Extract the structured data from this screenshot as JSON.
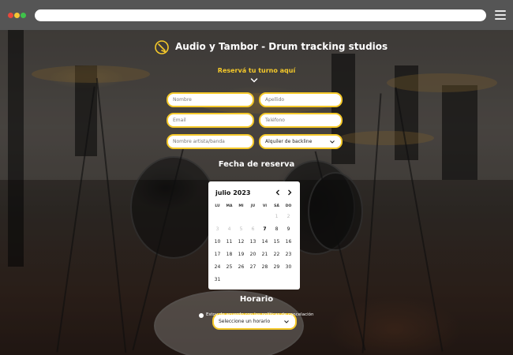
{
  "browser": {
    "url": ""
  },
  "header": {
    "title": "Audio y Tambor - Drum tracking studios",
    "subtitle": "Reservá tu turno aquí"
  },
  "form": {
    "nombre_placeholder": "Nombre",
    "apellido_placeholder": "Apellido",
    "email_placeholder": "Email",
    "telefono_placeholder": "Teléfono",
    "artista_placeholder": "Nombre artista/banda",
    "backline_selected": "Alquiler de backline"
  },
  "fecha": {
    "title": "Fecha de reserva"
  },
  "calendar": {
    "month_label": "julio 2023",
    "weekdays": [
      "LU",
      "MA",
      "MI",
      "JU",
      "VI",
      "SÁ",
      "DO"
    ],
    "weeks": [
      [
        "",
        "",
        "",
        "",
        "",
        "1",
        "2"
      ],
      [
        "3",
        "4",
        "5",
        "6",
        "7",
        "8",
        "9"
      ],
      [
        "10",
        "11",
        "12",
        "13",
        "14",
        "15",
        "16"
      ],
      [
        "17",
        "18",
        "19",
        "20",
        "21",
        "22",
        "23"
      ],
      [
        "24",
        "25",
        "26",
        "27",
        "28",
        "29",
        "30"
      ],
      [
        "31",
        "",
        "",
        "",
        "",
        "",
        ""
      ]
    ],
    "disabled_days": [
      "1",
      "2",
      "3",
      "4",
      "5",
      "6"
    ],
    "today": "7"
  },
  "horario": {
    "title": "Horario",
    "selected": "Seleccione un horario"
  },
  "terms": {
    "label": "Estoy de acuerdo con las políticas de cancelación"
  },
  "colors": {
    "accent": "#f5c92a",
    "chrome": "#555555"
  }
}
